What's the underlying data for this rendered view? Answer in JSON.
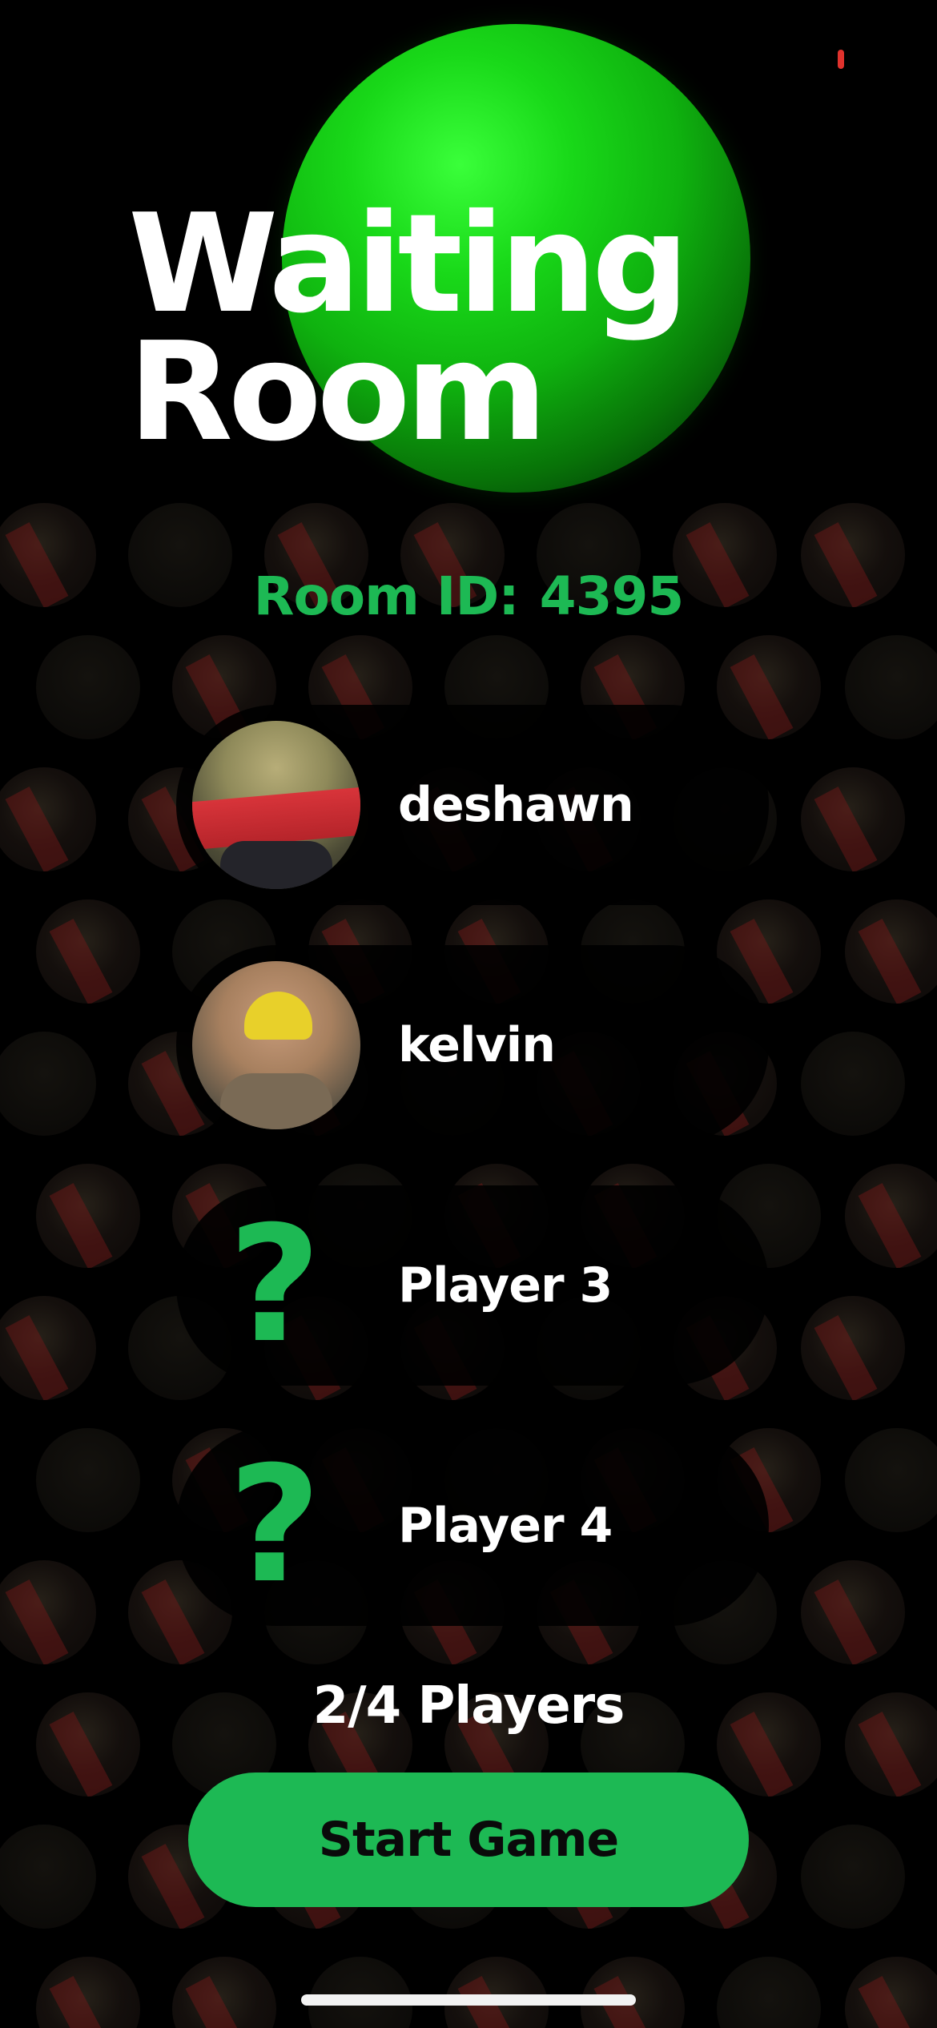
{
  "header": {
    "title_line1": "Waiting",
    "title_line2": "Room"
  },
  "room": {
    "label": "Room ID:",
    "id": "4395"
  },
  "players": [
    {
      "name": "deshawn",
      "avatar": "frog-avatar"
    },
    {
      "name": "kelvin",
      "avatar": "kid-avatar"
    },
    {
      "name": "Player 3",
      "placeholder_glyph": "?"
    },
    {
      "name": "Player 4",
      "placeholder_glyph": "?"
    }
  ],
  "player_count": "2/4 Players",
  "actions": {
    "start_label": "Start Game"
  },
  "colors": {
    "accent": "#1db954",
    "background": "#000000",
    "text": "#ffffff",
    "status_dot": "#e0322d"
  }
}
